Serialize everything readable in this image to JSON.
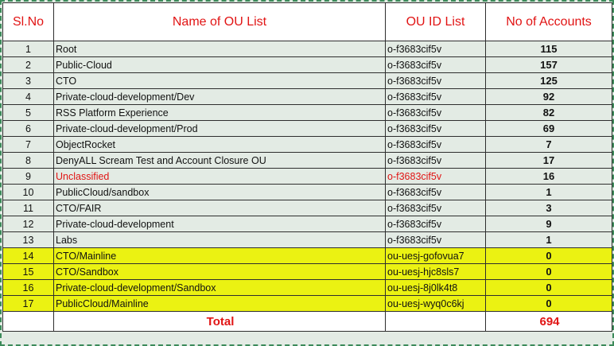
{
  "headers": {
    "sl_no": "Sl.No",
    "ou_name": "Name of OU List",
    "ou_id": "OU ID List",
    "accounts": "No of Accounts"
  },
  "rows": [
    {
      "sl": "1",
      "name": "Root",
      "id": "o-f3683cif5v",
      "count": "115"
    },
    {
      "sl": "2",
      "name": "Public-Cloud",
      "id": "o-f3683cif5v",
      "count": "157"
    },
    {
      "sl": "3",
      "name": "CTO",
      "id": "o-f3683cif5v",
      "count": "125"
    },
    {
      "sl": "4",
      "name": "Private-cloud-development/Dev",
      "id": "o-f3683cif5v",
      "count": "92"
    },
    {
      "sl": "5",
      "name": "RSS Platform Experience",
      "id": "o-f3683cif5v",
      "count": "82"
    },
    {
      "sl": "6",
      "name": "Private-cloud-development/Prod",
      "id": "o-f3683cif5v",
      "count": "69"
    },
    {
      "sl": "7",
      "name": "ObjectRocket",
      "id": "o-f3683cif5v",
      "count": "7"
    },
    {
      "sl": "8",
      "name": "DenyALL Scream Test and Account Closure OU",
      "id": "o-f3683cif5v",
      "count": "17"
    },
    {
      "sl": "9",
      "name": "Unclassified",
      "id": "o-f3683cif5v",
      "count": "16"
    },
    {
      "sl": "10",
      "name": "PublicCloud/sandbox",
      "id": "o-f3683cif5v",
      "count": "1"
    },
    {
      "sl": "11",
      "name": "CTO/FAIR",
      "id": "o-f3683cif5v",
      "count": "3"
    },
    {
      "sl": "12",
      "name": "Private-cloud-development",
      "id": "o-f3683cif5v",
      "count": "9"
    },
    {
      "sl": "13",
      "name": "Labs",
      "id": "o-f3683cif5v",
      "count": "1"
    },
    {
      "sl": "14",
      "name": "CTO/Mainline",
      "id": "ou-uesj-gofovua7",
      "count": "0"
    },
    {
      "sl": "15",
      "name": "CTO/Sandbox",
      "id": "ou-uesj-hjc8sls7",
      "count": "0"
    },
    {
      "sl": "16",
      "name": "Private-cloud-development/Sandbox",
      "id": "ou-uesj-8j0lk4t8",
      "count": "0"
    },
    {
      "sl": "17",
      "name": "PublicCloud/Mainline",
      "id": "ou-uesj-wyq0c6kj",
      "count": "0"
    }
  ],
  "footer": {
    "total_label": "Total",
    "total_value": "694"
  },
  "colors": {
    "header_text": "#e11414",
    "row_background": "#e3ebe4",
    "highlight": "#ebf212",
    "unclassified_text": "#e11414"
  }
}
